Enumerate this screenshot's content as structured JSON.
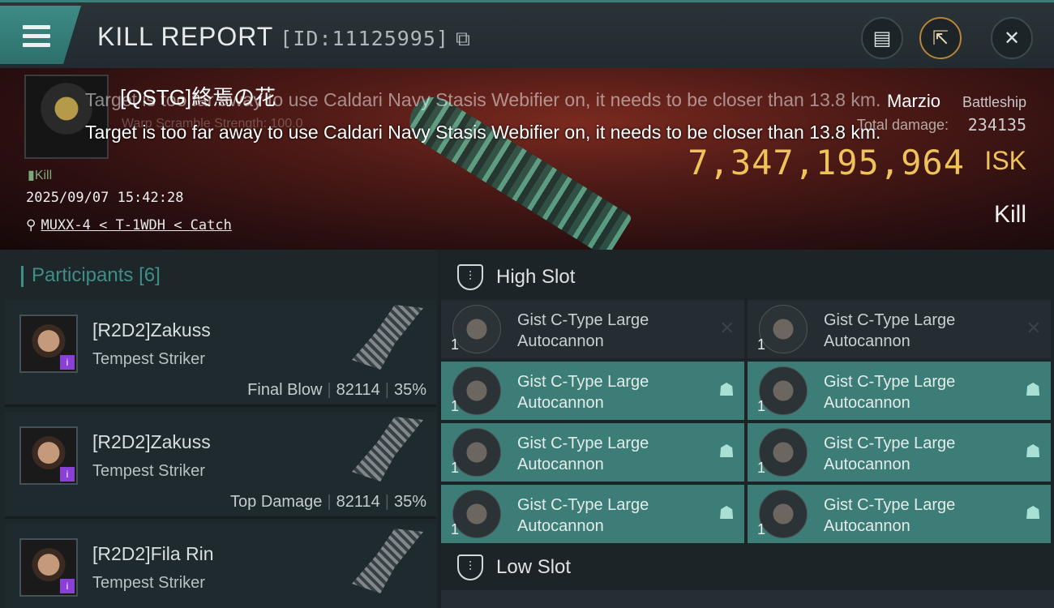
{
  "header": {
    "title": "KILL REPORT",
    "id_label": "[ID:11125995]",
    "copy_icon": "copy-icon",
    "actions": [
      {
        "name": "clipboard-icon",
        "glyph": "▤"
      },
      {
        "name": "share-icon",
        "glyph": "⇱"
      },
      {
        "name": "close-icon",
        "glyph": "✕"
      }
    ]
  },
  "victim": {
    "pilot": "[QSTG]終焉の花",
    "status": "Kill",
    "datetime": "2025/09/07 15:42:28",
    "location": "MUXX-4 < T-1WDH < Catch",
    "ship": "Marzio",
    "ship_class": "Battleship",
    "total_damage_label": "Total damage:",
    "total_damage": "234135",
    "isk_value": "7,347,195,964",
    "isk_unit": "ISK",
    "result": "Kill",
    "warp_ghost": "Warp Scramble Strength: 100.0"
  },
  "overlay_messages": [
    "Target is too far away to use Caldari Navy Stasis Webifier on, it needs to be closer than 13.8 km.",
    "Target is too far away to use Caldari Navy Stasis Webifier on, it needs to be closer than 13.8 km."
  ],
  "participants": {
    "label": "Participants",
    "count": "[6]",
    "rows": [
      {
        "name": "[R2D2]Zakuss",
        "ship": "Tempest Striker",
        "tag": "Final Blow",
        "damage": "82114",
        "percent": "35%"
      },
      {
        "name": "[R2D2]Zakuss",
        "ship": "Tempest Striker",
        "tag": "Top Damage",
        "damage": "82114",
        "percent": "35%"
      },
      {
        "name": "[R2D2]Fila Rin",
        "ship": "Tempest Striker",
        "tag": "",
        "damage": "",
        "percent": ""
      }
    ]
  },
  "slots": {
    "high_label": "High Slot",
    "low_label": "Low Slot",
    "high_modules": [
      {
        "name": "Gist C-Type Large Autocannon",
        "qty": "1",
        "state": "destroyed"
      },
      {
        "name": "Gist C-Type Large Autocannon",
        "qty": "1",
        "state": "destroyed"
      },
      {
        "name": "Gist C-Type Large Autocannon",
        "qty": "1",
        "state": "dropped"
      },
      {
        "name": "Gist C-Type Large Autocannon",
        "qty": "1",
        "state": "dropped"
      },
      {
        "name": "Gist C-Type Large Autocannon",
        "qty": "1",
        "state": "dropped"
      },
      {
        "name": "Gist C-Type Large Autocannon",
        "qty": "1",
        "state": "dropped"
      },
      {
        "name": "Gist C-Type Large Autocannon",
        "qty": "1",
        "state": "dropped"
      },
      {
        "name": "Gist C-Type Large Autocannon",
        "qty": "1",
        "state": "dropped"
      }
    ]
  },
  "colors": {
    "accent": "#3d7d77",
    "isk": "#f0c35a",
    "badge": "#8a3fd6"
  }
}
